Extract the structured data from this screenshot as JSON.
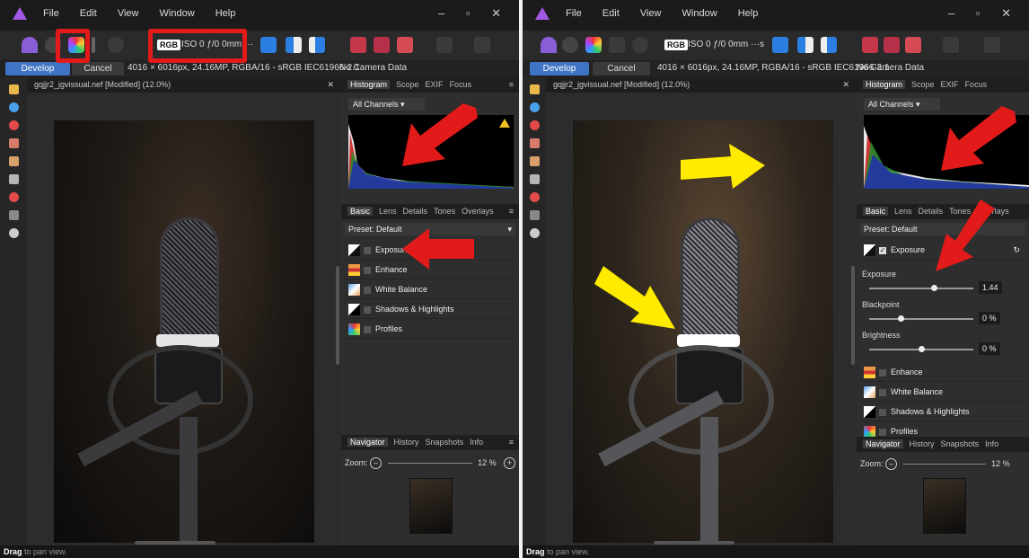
{
  "menu": [
    "File",
    "Edit",
    "View",
    "Window",
    "Help"
  ],
  "toolbar": {
    "rgb": "RGB",
    "iso_a": "ISO 0 ƒ/0 0mm ···",
    "iso_b": "ISO 0 ƒ/0 0mm ···s"
  },
  "context": {
    "develop": "Develop",
    "cancel": "Cancel",
    "info": "4016 × 6016px, 24.16MP, RGBA/16 - sRGB IEC61966-2.1",
    "no_camera": "No Camera Data"
  },
  "document": {
    "tab_a": "gqjjr2_jgvissual.nef [Modified] (12.0%)",
    "tab_b": "gqjjr2_jgvissual.nef [Modified] (12.0%)"
  },
  "panels": {
    "top_tabs": [
      "Histogram",
      "Scope",
      "EXIF",
      "Focus"
    ],
    "channels": "All Channels",
    "adjust_tabs": [
      "Basic",
      "Lens",
      "Details",
      "Tones",
      "Overlays"
    ],
    "preset": "Preset: Default",
    "items": [
      "Exposure",
      "Enhance",
      "White Balance",
      "Shadows & Highlights",
      "Profiles"
    ],
    "sliders": [
      {
        "label": "Exposure",
        "value": "1.44",
        "pos": 0.62
      },
      {
        "label": "Blackpoint",
        "value": "0 %",
        "pos": 0.3
      },
      {
        "label": "Brightness",
        "value": "0 %",
        "pos": 0.5
      }
    ],
    "nav_tabs": [
      "Navigator",
      "History",
      "Snapshots",
      "Info"
    ],
    "zoom_label": "Zoom:",
    "zoom_value": "12 %"
  },
  "status": {
    "bold": "Drag",
    "rest": " to pan view."
  },
  "colors": {
    "annotation_red": "#e21a1a",
    "annotation_yellow": "#ffeb00",
    "develop_blue": "#3f73c4"
  }
}
